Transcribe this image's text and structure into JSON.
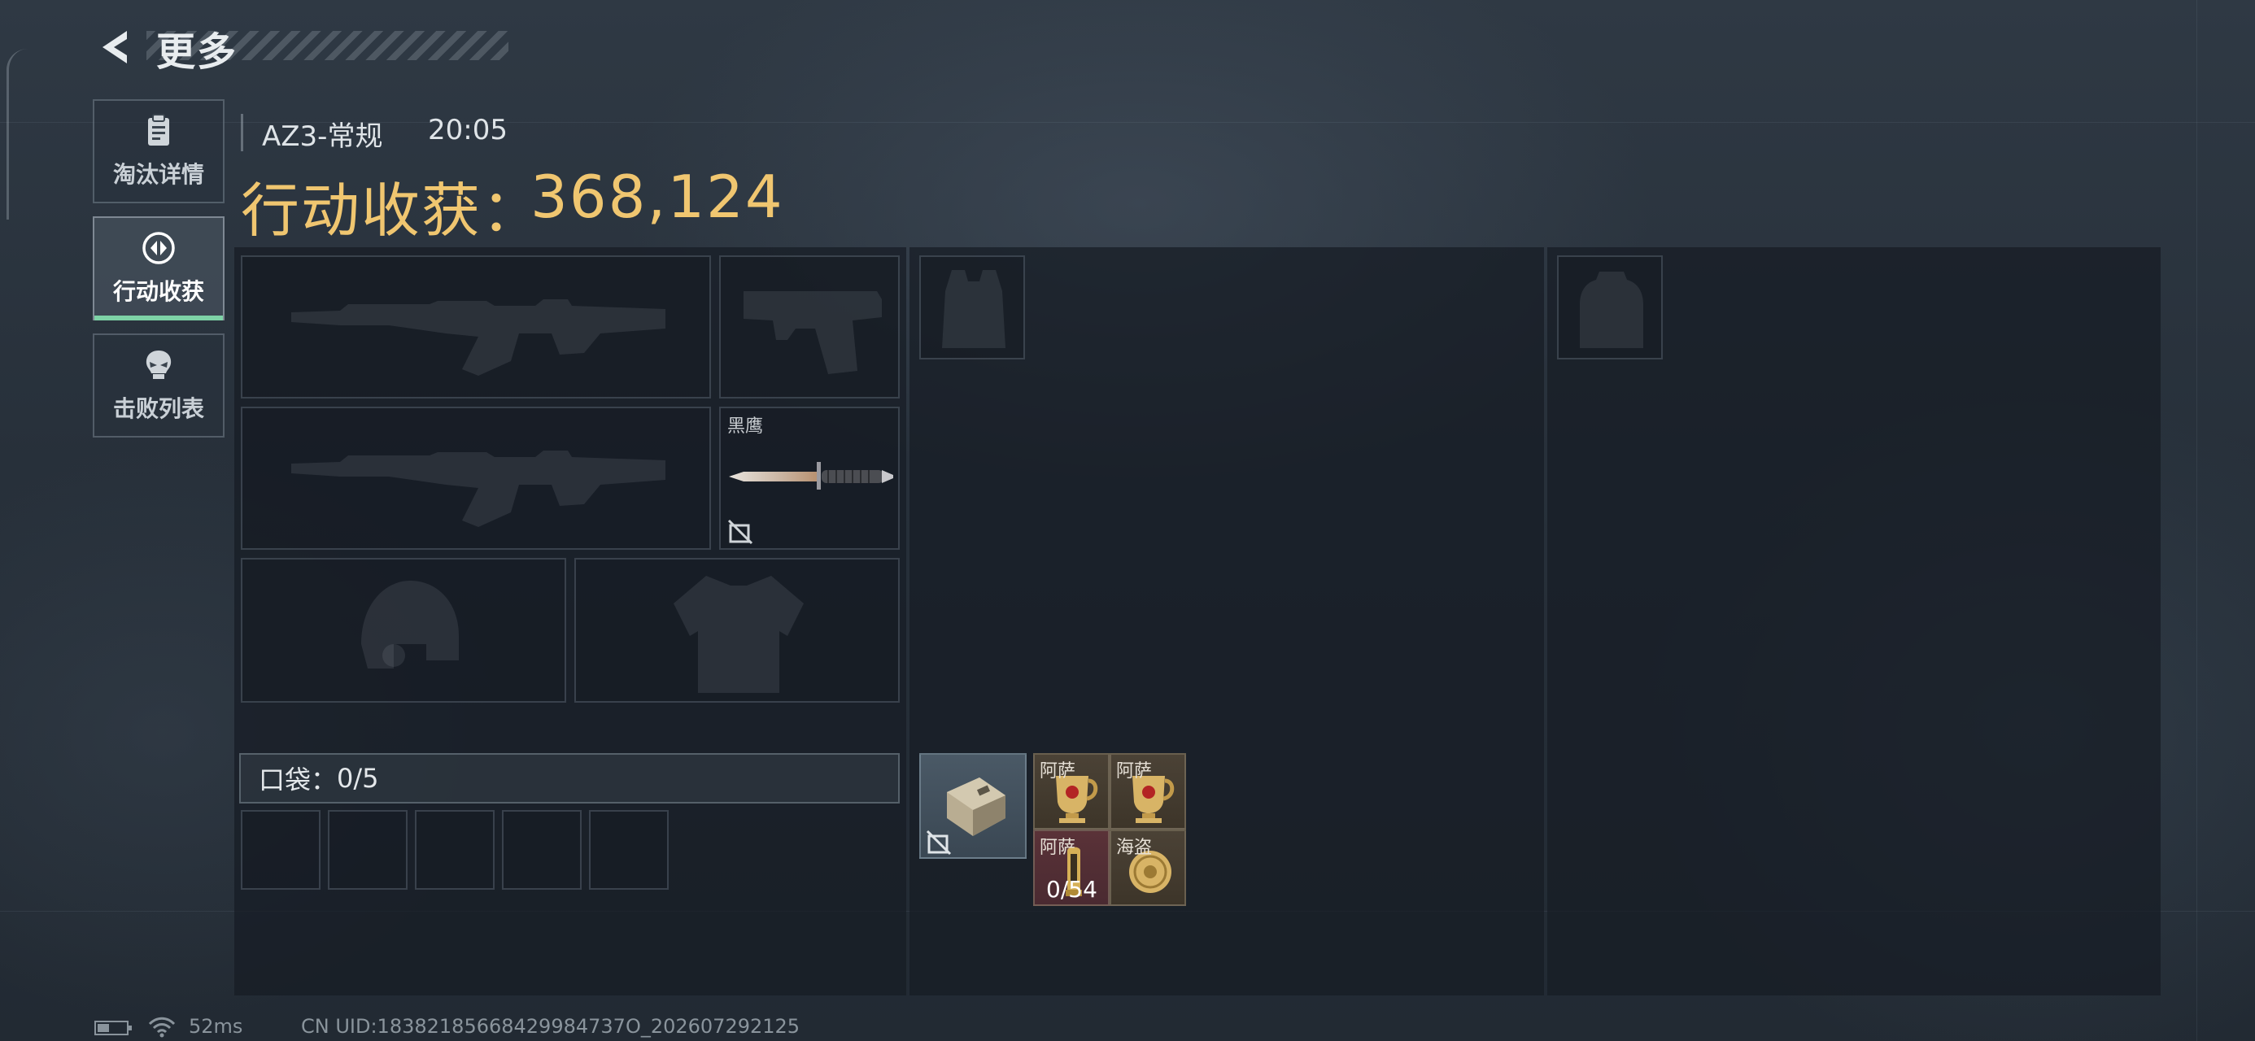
{
  "header": {
    "title": "更多"
  },
  "nav": {
    "items": [
      {
        "label": "淘汰详情",
        "icon": "clipboard-icon",
        "active": false
      },
      {
        "label": "行动收获",
        "icon": "loot-icon",
        "active": true
      },
      {
        "label": "击败列表",
        "icon": "skull-icon",
        "active": false
      }
    ]
  },
  "match": {
    "map": "AZ3-常规",
    "time": "20:05"
  },
  "loot": {
    "label": "行动收获：",
    "value": "368,124"
  },
  "equipment": {
    "primary_1": {
      "icon": "rifle-icon"
    },
    "pistol": {
      "icon": "pistol-icon"
    },
    "primary_2": {
      "icon": "rifle-icon"
    },
    "melee": {
      "name": "黑鹰",
      "icon": "knife-icon",
      "locked_icon": "no-trade-icon"
    },
    "helmet": {
      "icon": "helmet-icon"
    },
    "armor": {
      "icon": "armor-icon"
    },
    "chest_rig": {
      "icon": "vest-icon"
    },
    "backpack": {
      "icon": "backpack-icon"
    }
  },
  "pocket": {
    "label": "口袋：",
    "count": "0/5",
    "slots": 5
  },
  "container": {
    "icon": "safe-box-icon",
    "locked_icon": "no-trade-icon"
  },
  "items": [
    {
      "name": "阿萨",
      "icon": "gold-cup-icon",
      "rarity": "gold"
    },
    {
      "name": "阿萨",
      "icon": "gold-cup-icon",
      "rarity": "gold"
    },
    {
      "name": "阿萨",
      "icon": "ammo-icon",
      "rarity": "red",
      "count": "0/54"
    },
    {
      "name": "海盗",
      "icon": "gold-coin-icon",
      "rarity": "gold"
    }
  ],
  "footer": {
    "ping": "52ms",
    "uid": "CN UID:18382185668429984737O_202607292125"
  },
  "colors": {
    "accent": "#7ed3a7",
    "loot_gold": "#f0c670"
  }
}
